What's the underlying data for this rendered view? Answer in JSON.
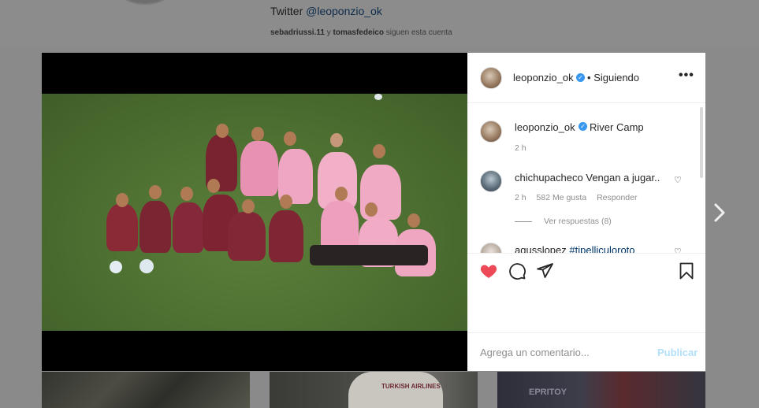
{
  "profile": {
    "twitter_prefix": "Twitter",
    "twitter_handle": "@leoponzio_ok",
    "followers_user1": "sebadriussi.11",
    "followers_joiner": "y",
    "followers_user2": "tomasfedeico",
    "followers_suffix": "siguen esta cuenta"
  },
  "post": {
    "header": {
      "username": "leoponzio_ok",
      "separator": "•",
      "follow_status": "Siguiendo",
      "more_label": "•••"
    },
    "caption": {
      "username": "leoponzio_ok",
      "text": "River Camp",
      "time": "2 h"
    },
    "comments": [
      {
        "username": "chichupacheco",
        "text": "Vengan a jugar..",
        "time": "2 h",
        "likes": "582 Me gusta",
        "reply": "Responder",
        "view_replies": "Ver respuestas (8)"
      },
      {
        "username": "agusslopez",
        "text": "#tipelliculoroto"
      }
    ],
    "add_comment": {
      "placeholder": "Agrega un comentario...",
      "publish": "Publicar"
    },
    "colors": {
      "like_active": "#ed4956",
      "verified": "#3897f0",
      "publish_disabled": "#b2dffc"
    }
  },
  "thumbs": {
    "thumb2_text": "TURKISH AIRLINES",
    "thumb3_text": "EPRITOY"
  }
}
